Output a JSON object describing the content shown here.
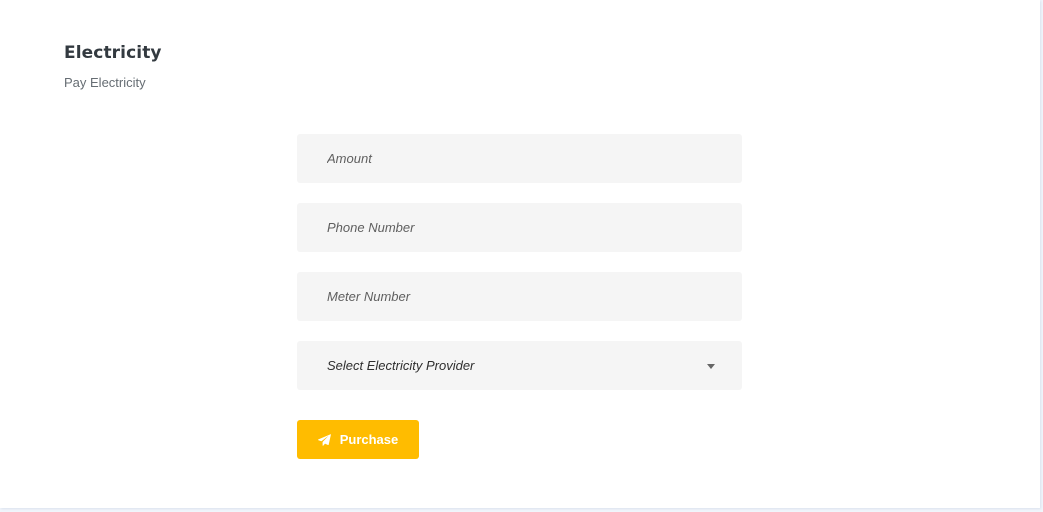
{
  "header": {
    "title": "Electricity",
    "subtitle": "Pay Electricity"
  },
  "form": {
    "amount": {
      "placeholder": "Amount",
      "value": ""
    },
    "phone": {
      "placeholder": "Phone Number",
      "value": ""
    },
    "meter": {
      "placeholder": "Meter Number",
      "value": ""
    },
    "provider": {
      "selected": "Select Electricity Provider",
      "icon": "chevron-down-icon"
    },
    "submit": {
      "label": "Purchase",
      "icon": "paper-plane-icon"
    }
  },
  "colors": {
    "accent": "#ffbc00",
    "field_bg": "#f5f5f5",
    "page_bg": "#f1f5fb",
    "title": "#333a40"
  }
}
